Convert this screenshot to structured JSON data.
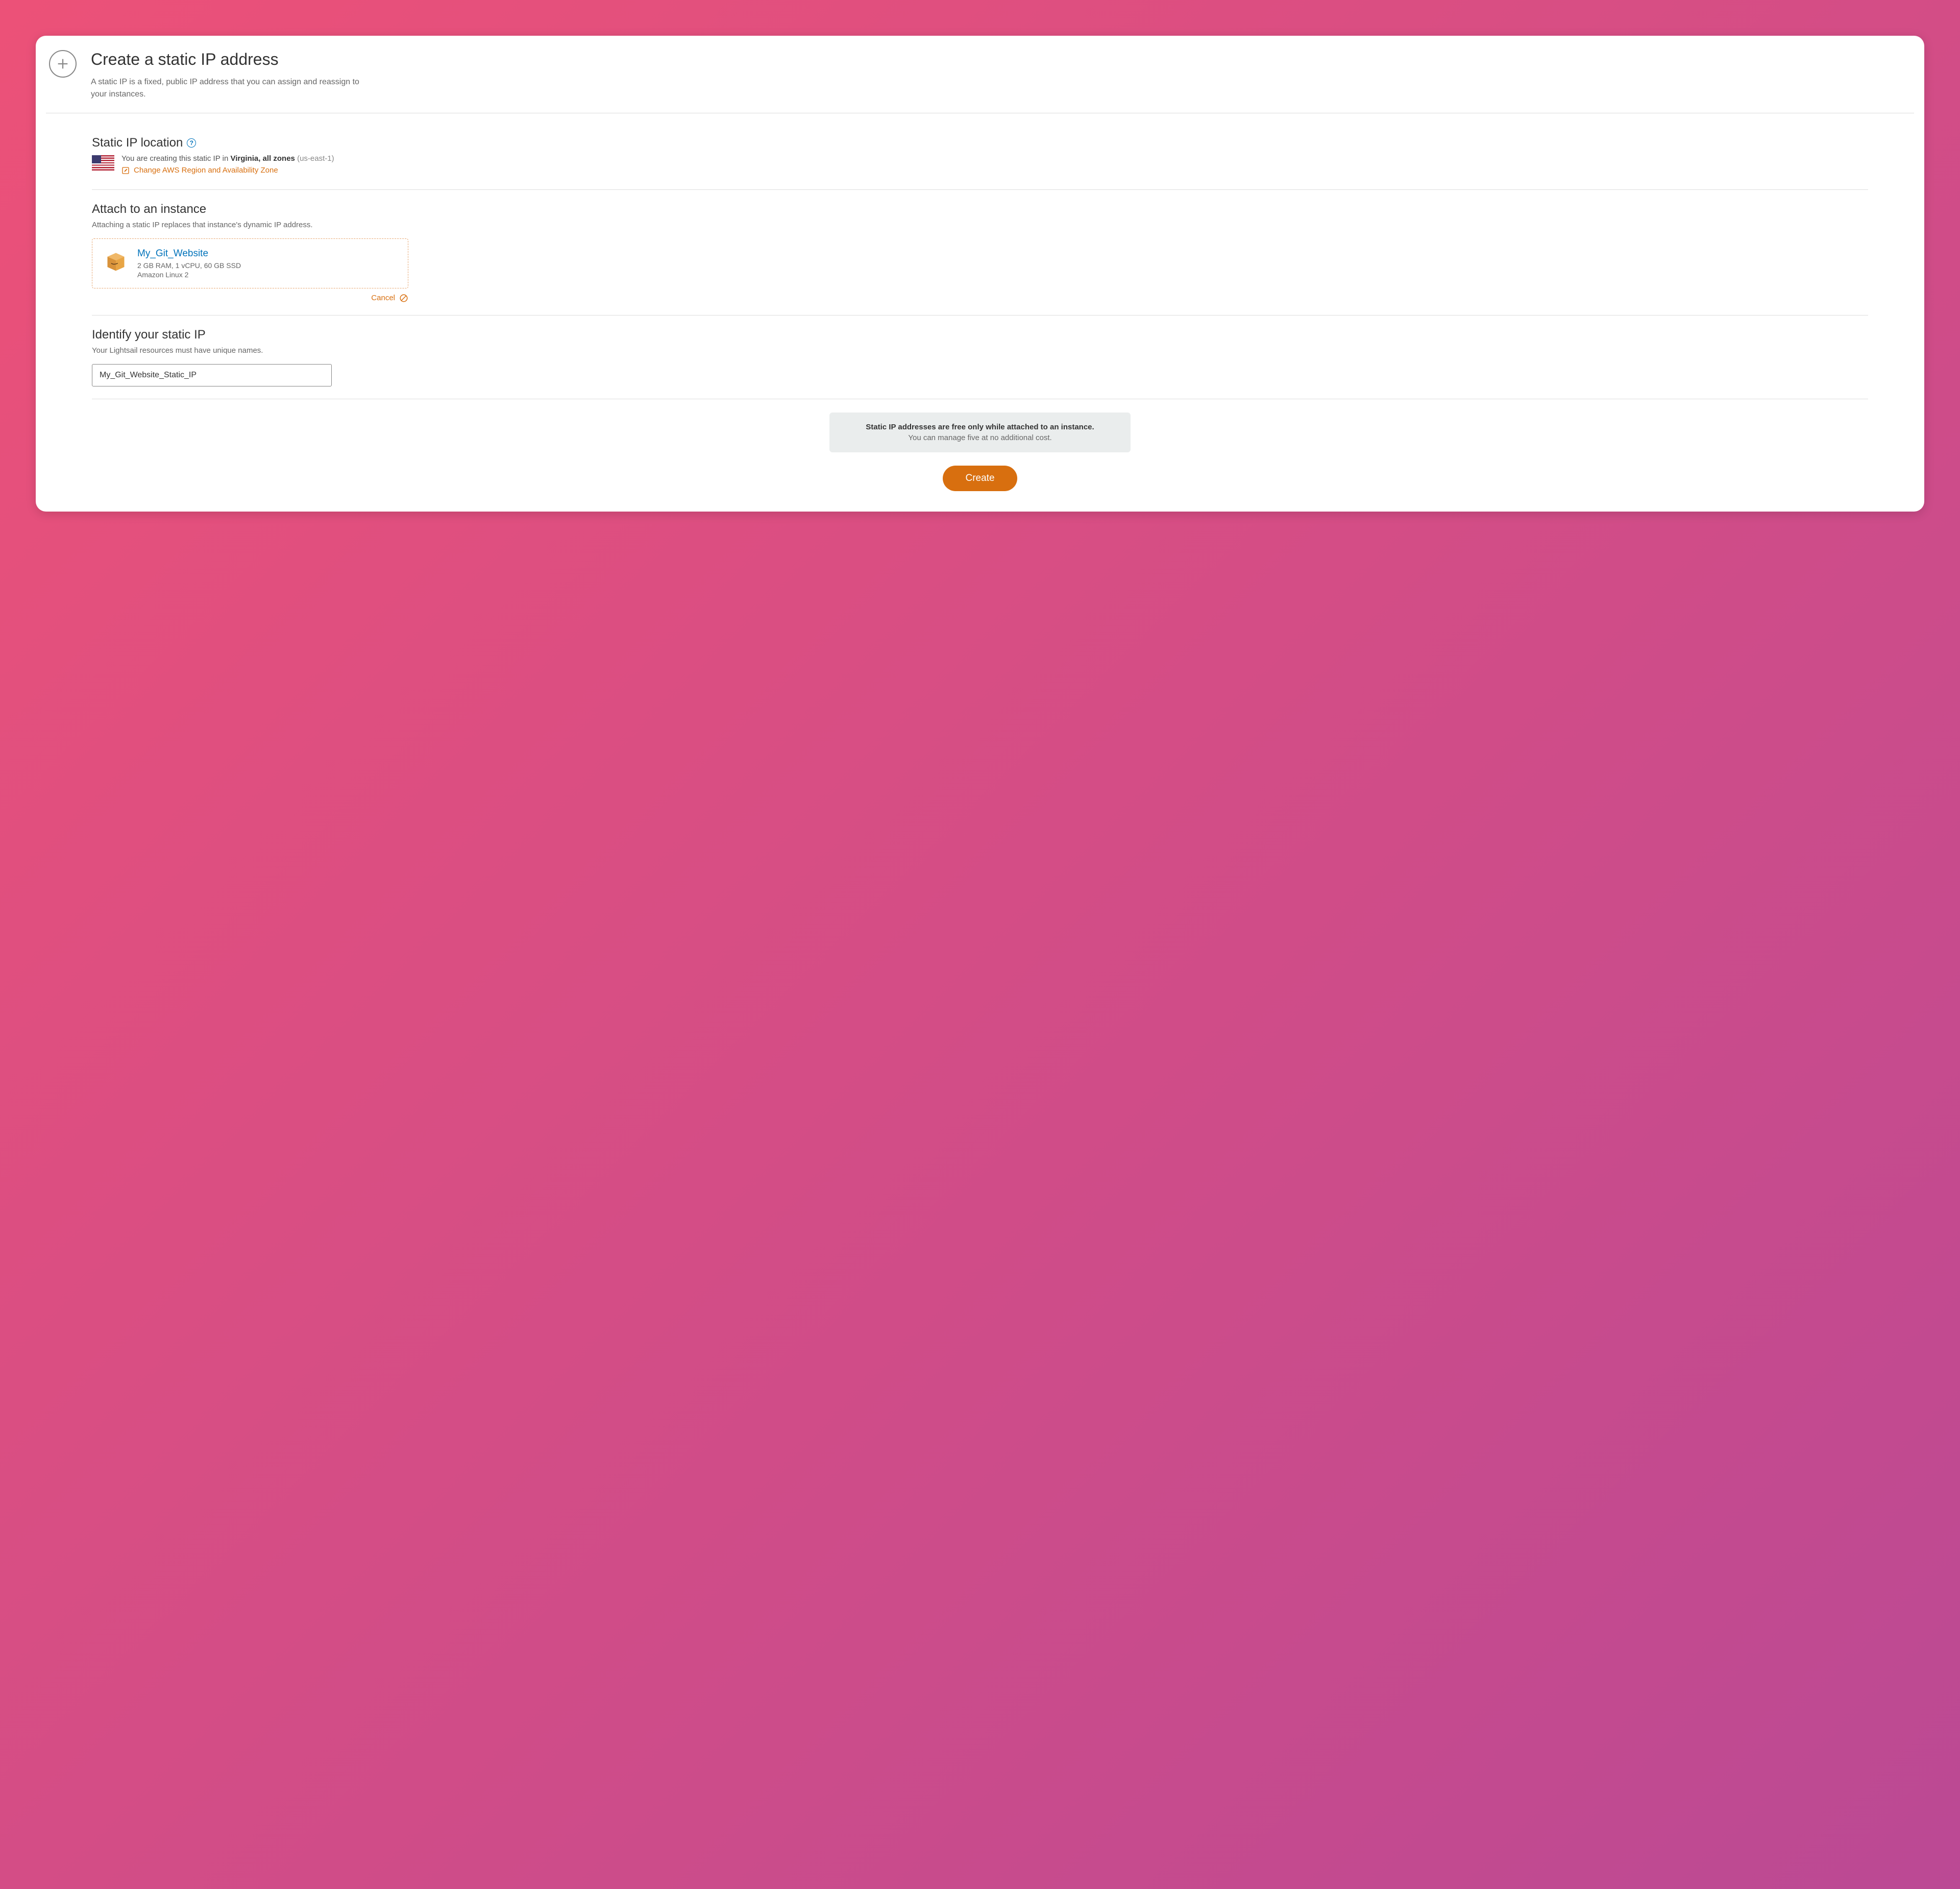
{
  "header": {
    "title": "Create a static IP address",
    "subtitle": "A static IP is a fixed, public IP address that you can assign and reassign to your instances."
  },
  "location": {
    "heading": "Static IP location",
    "prefix": "You are creating this static IP in ",
    "region_bold": "Virginia, all zones",
    "region_code": "(us-east-1)",
    "change_link": "Change AWS Region and Availability Zone"
  },
  "attach": {
    "heading": "Attach to an instance",
    "subtitle": "Attaching a static IP replaces that instance's dynamic IP address.",
    "instance": {
      "name": "My_Git_Website",
      "specs": "2 GB RAM, 1 vCPU, 60 GB SSD",
      "os": "Amazon Linux 2"
    },
    "cancel": "Cancel"
  },
  "identify": {
    "heading": "Identify your static IP",
    "subtitle": "Your Lightsail resources must have unique names.",
    "value": "My_Git_Website_Static_IP"
  },
  "footer": {
    "info_bold": "Static IP addresses are free only while attached to an instance.",
    "info_sub": "You can manage five at no additional cost.",
    "create": "Create"
  }
}
